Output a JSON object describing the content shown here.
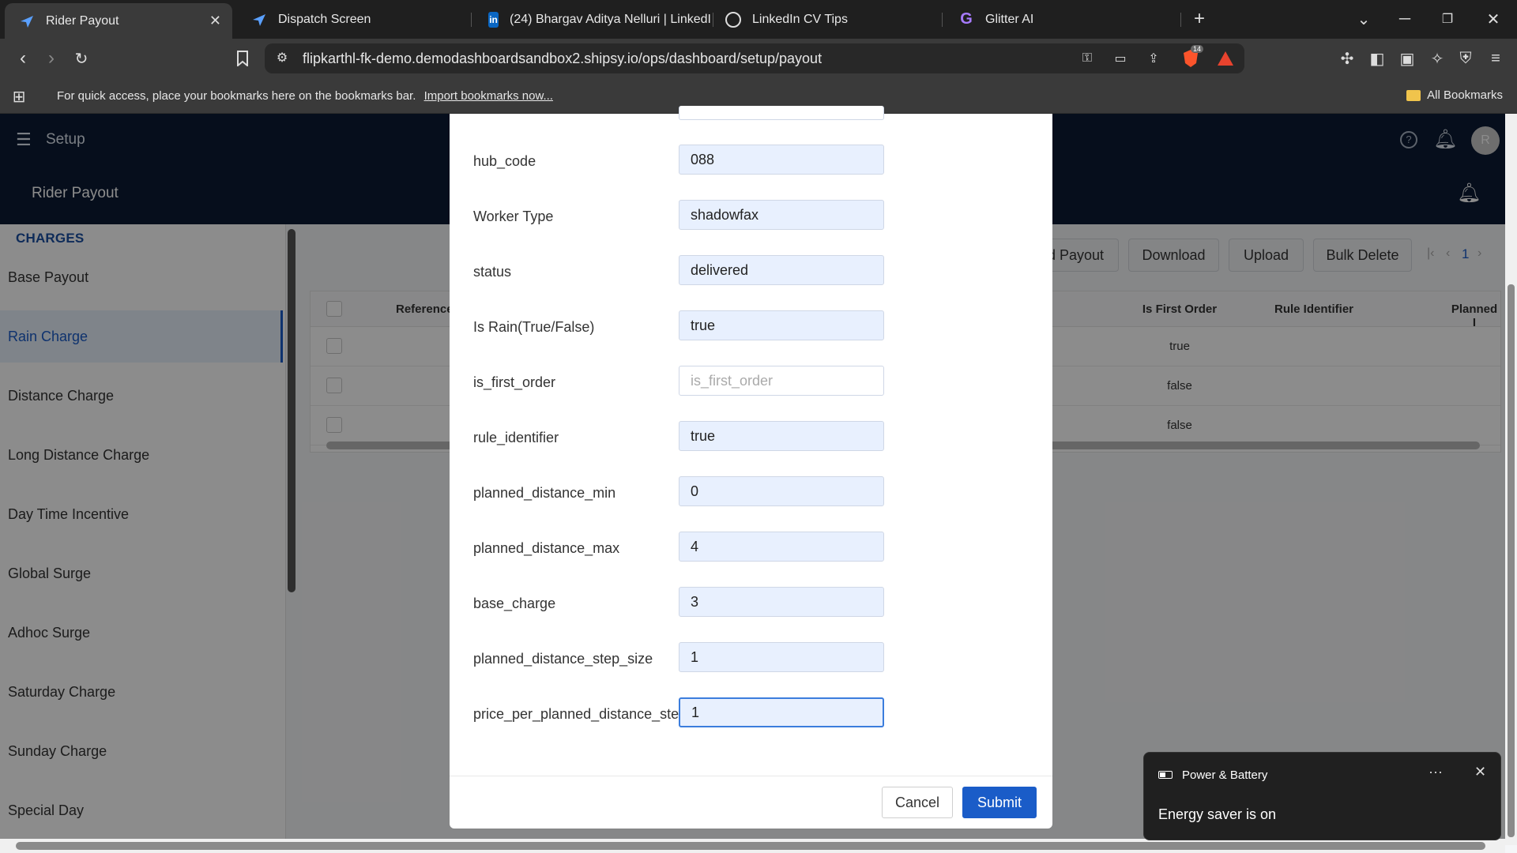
{
  "browser": {
    "tabs": [
      {
        "title": "Rider Payout",
        "active": true
      },
      {
        "title": "Dispatch Screen",
        "active": false
      },
      {
        "title": "(24) Bhargav Aditya Nelluri | LinkedI",
        "active": false
      },
      {
        "title": "LinkedIn CV Tips",
        "active": false
      },
      {
        "title": "Glitter AI",
        "active": false
      }
    ],
    "url": "flipkarthl-fk-demo.demodashboardsandbox2.shipsy.io/ops/dashboard/setup/payout",
    "bookmarks_message": "For quick access, place your bookmarks here on the bookmarks bar.",
    "import_link": "Import bookmarks now...",
    "all_bookmarks": "All Bookmarks",
    "brave_badge": "14"
  },
  "app": {
    "nav_title": "Setup",
    "page_title": "Rider Payout",
    "avatar_initial": "R",
    "sidebar": {
      "heading": "CHARGES",
      "items": [
        {
          "label": "Base Payout",
          "selected": false
        },
        {
          "label": "Rain Charge",
          "selected": true
        },
        {
          "label": "Distance Charge",
          "selected": false
        },
        {
          "label": "Long Distance Charge",
          "selected": false
        },
        {
          "label": "Day Time Incentive",
          "selected": false
        },
        {
          "label": "Global Surge",
          "selected": false
        },
        {
          "label": "Adhoc Surge",
          "selected": false
        },
        {
          "label": "Saturday Charge",
          "selected": false
        },
        {
          "label": "Sunday Charge",
          "selected": false
        },
        {
          "label": "Special Day",
          "selected": false
        }
      ]
    },
    "toolbar": {
      "add_payout": "d Payout",
      "download": "Download",
      "upload": "Upload",
      "bulk_delete": "Bulk Delete",
      "page": "1"
    },
    "table": {
      "headers": {
        "reference": "Reference",
        "is_first_order": "Is First Order",
        "rule_identifier": "Rule Identifier",
        "planned": "Planned I"
      },
      "rows": [
        {
          "is_first_order": "true"
        },
        {
          "is_first_order": "false"
        },
        {
          "is_first_order": "false"
        }
      ]
    }
  },
  "modal": {
    "fields": [
      {
        "label": "hub_code",
        "value": "088",
        "placeholder": ""
      },
      {
        "label": "Worker Type",
        "value": "shadowfax",
        "placeholder": ""
      },
      {
        "label": "status",
        "value": "delivered",
        "placeholder": ""
      },
      {
        "label": "Is Rain(True/False)",
        "value": "true",
        "placeholder": ""
      },
      {
        "label": "is_first_order",
        "value": "",
        "placeholder": "is_first_order"
      },
      {
        "label": "rule_identifier",
        "value": "true",
        "placeholder": ""
      },
      {
        "label": "planned_distance_min",
        "value": "0",
        "placeholder": ""
      },
      {
        "label": "planned_distance_max",
        "value": "4",
        "placeholder": ""
      },
      {
        "label": "base_charge",
        "value": "3",
        "placeholder": ""
      },
      {
        "label": "planned_distance_step_size",
        "value": "1",
        "placeholder": ""
      },
      {
        "label": "price_per_planned_distance_step",
        "value": "1",
        "placeholder": ""
      }
    ],
    "cancel_label": "Cancel",
    "submit_label": "Submit"
  },
  "toast": {
    "title": "Power & Battery",
    "body": "Energy saver is on"
  }
}
